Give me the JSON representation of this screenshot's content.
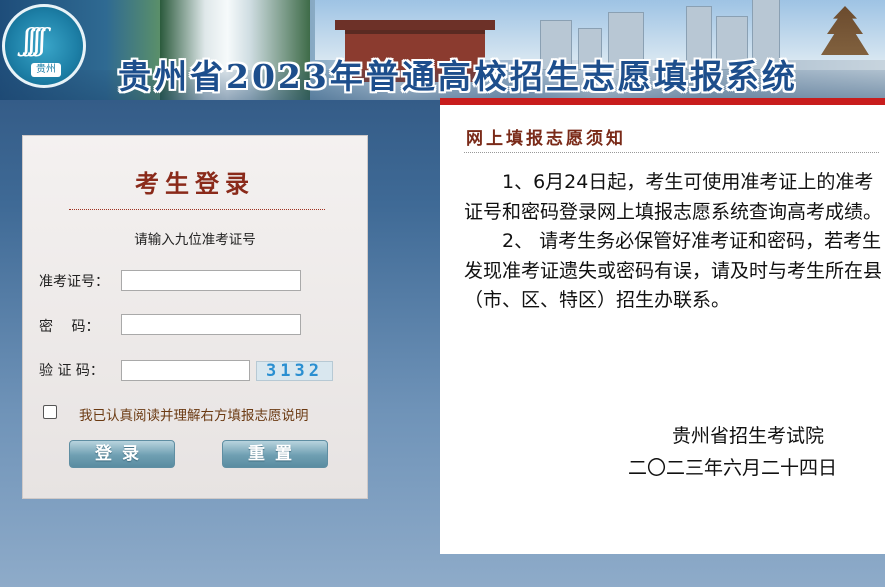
{
  "banner": {
    "title": "贵州省2023年普通高校招生志愿填报系统",
    "logo_text": "贵州"
  },
  "login": {
    "title": "考生登录",
    "hint": "请输入九位准考证号",
    "exam_id_label": "准考证号：",
    "password_label": "密　 码：",
    "captcha_label": "验 证 码：",
    "exam_id_value": "",
    "password_value": "",
    "captcha_value": "",
    "captcha_image_text": "3132",
    "agree_text": "我已认真阅读并理解右方填报志愿说明",
    "agree_checked": false,
    "login_button": "登录",
    "reset_button": "重置"
  },
  "notice": {
    "heading": "网上填报志愿须知",
    "items": [
      "1、6月24日起，考生可使用准考证上的准考证号和密码登录网上填报志愿系统查询高考成绩。",
      "2、 请考生务必保管好准考证和密码，若考生发现准考证遗失或密码有误，请及时与考生所在县（市、区、特区）招生办联系。"
    ],
    "signature_org": "贵州省招生考试院",
    "signature_date": "二〇二三年六月二十四日"
  },
  "colors": {
    "accent_red": "#c81d1d",
    "title_blue": "#1d4e8c",
    "login_title": "#8a2a1a",
    "button": "#6f9fb2"
  },
  "icons": {
    "logo": "exam-authority-logo-icon",
    "checkbox": "checkbox-icon"
  }
}
